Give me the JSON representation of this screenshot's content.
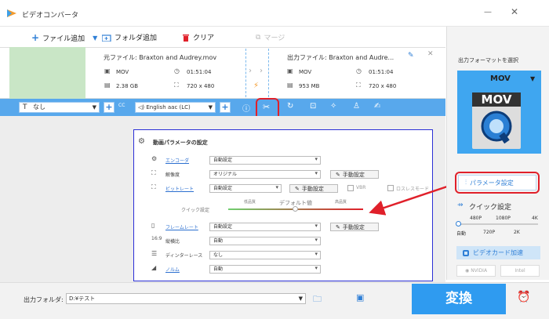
{
  "app": {
    "title": "ビデオコンバータ"
  },
  "toolbar": {
    "add_file": "ファイル追加",
    "add_folder": "フォルダ追加",
    "clear": "クリア",
    "merge": "マージ"
  },
  "file": {
    "source_label": "元ファイル: Braxton and Audrey.mov",
    "source_format": "MOV",
    "source_duration": "01:51:04",
    "source_size": "2.38 GB",
    "source_res": "720 x 480",
    "output_label": "出力ファイル: Braxton and Audre...",
    "output_format": "MOV",
    "output_duration": "01:51:04",
    "output_size": "953 MB",
    "output_res": "720 x 480"
  },
  "editbar": {
    "subtitle": "なし",
    "audio": "English aac (LC)",
    "cc": "CC"
  },
  "dialog": {
    "title": "動画パラメータの設定",
    "encoder_label": "エンコーダ",
    "encoder_value": "自動設定",
    "resolution_label": "解像度",
    "resolution_value": "オリジナル",
    "bitrate_label": "ビットレート",
    "bitrate_value": "自動設定",
    "vbr_label": "VBR",
    "lossless_label": "ロスレスモード",
    "quick_label": "クイック設定",
    "low_quality": "低品質",
    "default_value": "デフォルト値",
    "high_quality": "高品質",
    "framerate_label": "フレームレート",
    "framerate_value": "自動設定",
    "aspect_label": "縦横比",
    "aspect_value": "自動",
    "deinterlace_label": "ディンターレース",
    "deinterlace_value": "なし",
    "volume_label": "ノルム",
    "volume_value": "自動",
    "manual_btn": "手動設定"
  },
  "right": {
    "format_select_label": "出力フォーマットを選択",
    "format_value": "MOV",
    "format_icon_text": "MOV",
    "param_settings": "パラメータ設定",
    "quick_settings": "クイック設定",
    "q_480": "480P",
    "q_1080": "1080P",
    "q_4k": "4K",
    "q_auto": "自動",
    "q_720": "720P",
    "q_2k": "2K",
    "gpu_accel": "ビデオカード加速",
    "nvidia": "NVIDIA",
    "intel": "Intel"
  },
  "bottom": {
    "output_folder_label": "出力フォルダ:",
    "output_folder_value": "D:¥テスト",
    "convert": "変換"
  },
  "colors": {
    "accent": "#2f9bf0",
    "bar": "#58a8ec",
    "annotation": "#e0202a",
    "dialog_border": "#2b2fd6"
  }
}
